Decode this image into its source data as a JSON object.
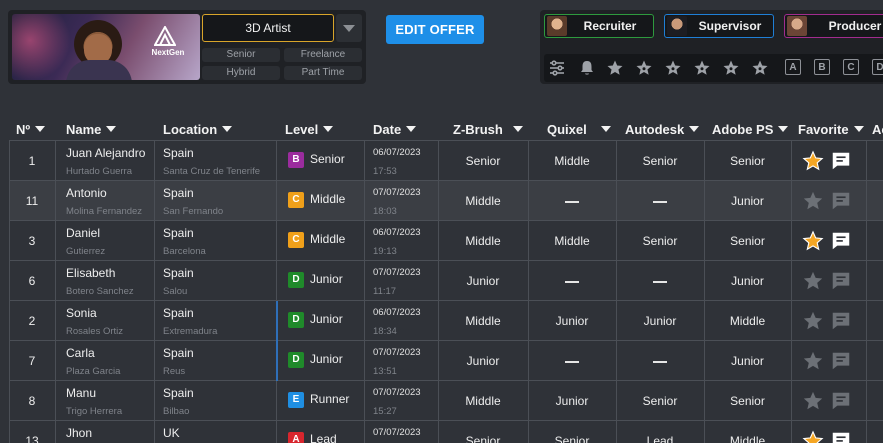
{
  "offer": {
    "banner_brand": "NextGen",
    "role_selected": "3D Artist",
    "chips": [
      "Senior",
      "Freelance",
      "Hybrid",
      "Part Time"
    ],
    "edit_label": "EDIT OFFER"
  },
  "roles": [
    {
      "label": "Recruiter",
      "border": "#2e9a3e"
    },
    {
      "label": "Supervisor",
      "border": "#1f7fd6"
    },
    {
      "label": "Producer",
      "border": "#a22c8e"
    }
  ],
  "filters": {
    "icons": [
      "sliders-icon",
      "bell-icon",
      "star-icon",
      "star-outline-icon",
      "star-outline-icon",
      "star-outline-icon",
      "star-outline-icon",
      "star-outline-icon"
    ],
    "letters": [
      "A",
      "B",
      "C",
      "D"
    ]
  },
  "table": {
    "columns": [
      "Nº",
      "Name",
      "Location",
      "Level",
      "Date",
      "Z-Brush",
      "Quixel",
      "Autodesk",
      "Adobe PS",
      "Favorite",
      "Ac"
    ],
    "rows": [
      {
        "no": "1",
        "first": "Juan Alejandro",
        "last": "Hurtado Guerra",
        "country": "Spain",
        "city": "Santa Cruz de Tenerife",
        "level_letter": "B",
        "level": "Senior",
        "date": "06/07/2023",
        "time": "17:53",
        "zbrush": "Senior",
        "quixel": "Middle",
        "autodesk": "Senior",
        "adobe": "Senior",
        "fav": true
      },
      {
        "no": "11",
        "first": "Antonio",
        "last": "Molina Fernandez",
        "country": "Spain",
        "city": "San Fernando",
        "level_letter": "C",
        "level": "Middle",
        "date": "07/07/2023",
        "time": "18:03",
        "zbrush": "Middle",
        "quixel": "—",
        "autodesk": "—",
        "adobe": "Junior",
        "fav": false
      },
      {
        "no": "3",
        "first": "Daniel",
        "last": "Gutierrez",
        "country": "Spain",
        "city": "Barcelona",
        "level_letter": "C",
        "level": "Middle",
        "date": "06/07/2023",
        "time": "19:13",
        "zbrush": "Middle",
        "quixel": "Middle",
        "autodesk": "Senior",
        "adobe": "Senior",
        "fav": true
      },
      {
        "no": "6",
        "first": "Elisabeth",
        "last": "Botero Sanchez",
        "country": "Spain",
        "city": "Salou",
        "level_letter": "D",
        "level": "Junior",
        "date": "07/07/2023",
        "time": "11:17",
        "zbrush": "Junior",
        "quixel": "—",
        "autodesk": "—",
        "adobe": "Junior",
        "fav": false
      },
      {
        "no": "2",
        "first": "Sonia",
        "last": "Rosales Ortiz",
        "country": "Spain",
        "city": "Extremadura",
        "level_letter": "D",
        "level": "Junior",
        "date": "06/07/2023",
        "time": "18:34",
        "zbrush": "Middle",
        "quixel": "Junior",
        "autodesk": "Junior",
        "adobe": "Middle",
        "fav": false
      },
      {
        "no": "7",
        "first": "Carla",
        "last": "Plaza Garcia",
        "country": "Spain",
        "city": "Reus",
        "level_letter": "D",
        "level": "Junior",
        "date": "07/07/2023",
        "time": "13:51",
        "zbrush": "Junior",
        "quixel": "—",
        "autodesk": "—",
        "adobe": "Junior",
        "fav": false
      },
      {
        "no": "8",
        "first": "Manu",
        "last": "Trigo Herrera",
        "country": "Spain",
        "city": "Bilbao",
        "level_letter": "E",
        "level": "Runner",
        "date": "07/07/2023",
        "time": "15:27",
        "zbrush": "Middle",
        "quixel": "Junior",
        "autodesk": "Senior",
        "adobe": "Senior",
        "fav": false
      },
      {
        "no": "13",
        "first": "Jhon",
        "last": "",
        "country": "UK",
        "city": "",
        "level_letter": "A",
        "level": "Lead",
        "date": "07/07/2023",
        "time": "",
        "zbrush": "Senior",
        "quixel": "Senior",
        "autodesk": "Lead",
        "adobe": "Middle",
        "fav": true
      }
    ]
  },
  "colors": {
    "accent": "#1e8fe8",
    "level_A": "#d8262e",
    "level_B": "#9b2c9e",
    "level_C": "#f0a01a",
    "level_D": "#1f8a2a",
    "level_E": "#1f8fe3",
    "star_active": "#f5a623"
  }
}
